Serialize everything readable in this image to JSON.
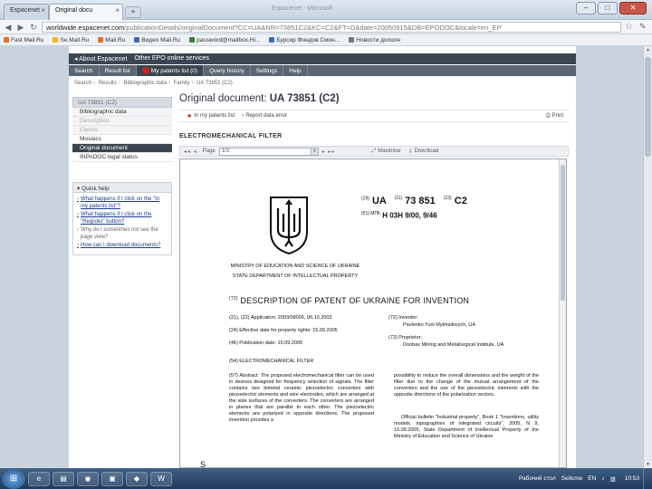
{
  "browser": {
    "tabs": [
      {
        "label": "Espacenet",
        "active": false
      },
      {
        "label": "Original docu",
        "active": true
      }
    ],
    "new_tab": "+",
    "window_title": "Espacenet - Microsoft",
    "window_buttons": [
      "–",
      "□",
      "✕"
    ],
    "nav": [
      "◀",
      "▶",
      "↻"
    ],
    "url_host": "worldwide.espacenet.com",
    "url_path": "/publicationDetails/originalDocument?CC=UA&NR=73851C2&KC=C2&FT=D&date=20050915&DB=EPODOC&locale=en_EP",
    "bookmarks": [
      {
        "label": "Fast Mail.Ru",
        "color": "#e0702c"
      },
      {
        "label": "Se.Mail.Ru",
        "color": "#f0b820"
      },
      {
        "label": "Mail.Ru",
        "color": "#e0702c"
      },
      {
        "label": "Видео Mail.Ru",
        "color": "#3b6bb8"
      },
      {
        "label": "password@mailbox.Hi...",
        "color": "#3b7a3b"
      },
      {
        "label": "Бурсир Фондов Смон...",
        "color": "#3b6bb8"
      },
      {
        "label": "Новости дополн",
        "color": "#777"
      }
    ]
  },
  "epo": {
    "top_left": "About Espacenet",
    "top_right": "Other EPO online services",
    "nav": [
      "Search",
      "Result list",
      "My patents list (0)",
      "Query history",
      "Settings",
      "Help"
    ],
    "breadcrumb": [
      "Search",
      "Results",
      "Bibliographic data",
      "Family",
      "UA 73851 (C2)"
    ]
  },
  "left_nav": {
    "header": "UA 73851 (C2)",
    "items": [
      {
        "label": "Bibliographic data",
        "state": "normal"
      },
      {
        "label": "Description",
        "state": "disabled"
      },
      {
        "label": "Claims",
        "state": "disabled"
      },
      {
        "label": "Mosaics",
        "state": "normal"
      },
      {
        "label": "Original document",
        "state": "active"
      },
      {
        "label": "INPADOC legal status",
        "state": "normal"
      }
    ]
  },
  "quick_help": {
    "title": "Quick help",
    "items": [
      {
        "label": "What happens if I click on the \"In my patents list\"?",
        "link": true
      },
      {
        "label": "What happens if I click on the \"Register\" button?",
        "link": true
      },
      {
        "label": "Why do I sometimes not see the page view?",
        "link": false
      },
      {
        "label": "How can I download documents?",
        "link": true
      }
    ]
  },
  "main": {
    "title_prefix": "Original document: ",
    "title_doc": "UA 73851  (C2)",
    "actions": {
      "patents_list": "In my patents list",
      "report_error": "Report data error",
      "print": "Print"
    },
    "document_name": "ELECTROMECHANICAL FILTER",
    "toolbar": {
      "nav_prev": "◂◂  ◂",
      "page_label": "Page",
      "page_value": "1/3",
      "nav_next": "▸  ▸▸",
      "maximise": "Maximise",
      "download": "Download"
    }
  },
  "patent": {
    "c11": "(11)",
    "c19": "(19)",
    "c13": "(13)",
    "c51": "(51) МПК",
    "country": "UA",
    "number": "73 851",
    "kind": "C2",
    "ipc": "H 03H 9/00, 9/46",
    "ministry": "MINISTRY OF EDUCATION AND SCIENCE OF UKRAINE",
    "department": "STATE DEPARTMENT OF INTELLECTUAL PROPERTY",
    "code72_title": "(72)",
    "description_title": "DESCRIPTION OF PATENT OF UKRAINE FOR INVENTION",
    "bib_left": [
      "(21), (22) Application: 2003/09006, 06.10.2003",
      "(24) Effective date for property rights: 15.09.2005",
      "(46) Publication date: 15.09.2005"
    ],
    "bib_right": [
      "(72) Inventor:",
      "Pavlenko Yurii Mykhailovych, UA",
      "(73) Proprietor:",
      "Donbas Mining and Metallurgical Institute, UA"
    ],
    "title54": "(54) ELECTROMECHANICAL FILTER",
    "abstract_left": "(57) Abstract: The proposed electromechanical filter can be used in devices designed for frequency selection of signals. The filter contains two bimetal ceramic piezoelectric converters with piezoelectric elements and wire electrodes, which are arranged at the side surfaces of the converters. The converters are arranged in planes that are parallel to each other. The piezoelectric elements are polarized in opposite directions. The proposed invention provides a",
    "abstract_right": "possibility to reduce the overall dimensions and the weight of the filter due to the change of the mutual arrangement of the converters and the use of the piezoelectric elements with the opposite directions of the polarization vectors.",
    "bulletin": "Official bulletin \"Industrial property\", Book 1 \"Inventions, utility models, topographies of integrated circuits\", 2005, N 9, 15.09.2005, State Department of Intellectual Property of the Ministry of Education and Science of Ukraine",
    "page_mark": "S"
  },
  "taskbar": {
    "start": "⊞",
    "apps": [
      "e",
      "▤",
      "◉",
      "▣",
      "◆",
      "W"
    ],
    "tray_label": "Рабочий стол",
    "tray_item": "Seitcme",
    "lang": "EN",
    "clock": "10:53"
  }
}
